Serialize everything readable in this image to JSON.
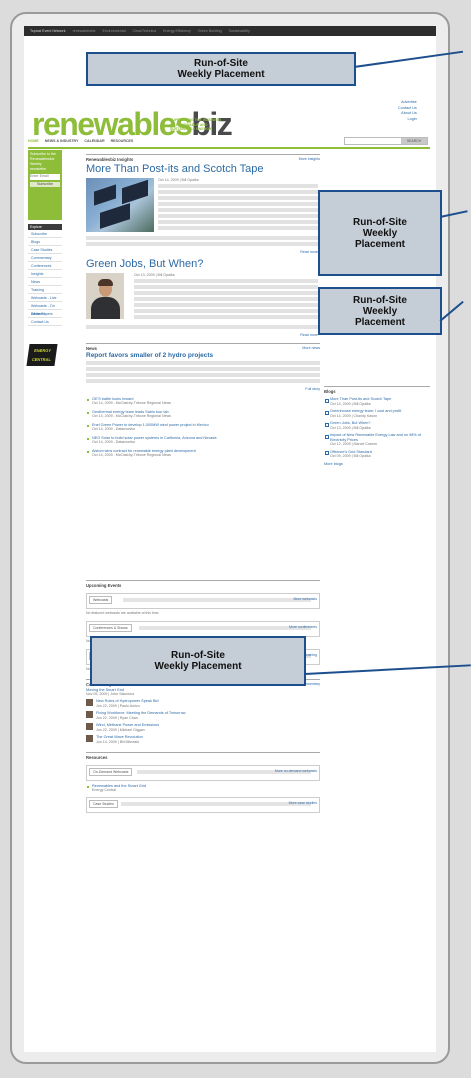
{
  "topbar": {
    "items": [
      "Topical Event Network",
      "renewablesbiz",
      "Environmental",
      "CleanTechnica",
      "Energy Efficiency",
      "Green Building",
      "Sustainability"
    ]
  },
  "placements": {
    "top": {
      "line1": "Run-of-Site",
      "line2": "Weekly Placement"
    },
    "right1": {
      "line1": "Run-of-Site",
      "line2": "Weekly",
      "line3": "Placement"
    },
    "right2": {
      "line1": "Run-of-Site",
      "line2": "Weekly",
      "line3": "Placement"
    },
    "middle": {
      "line1": "Run-of-Site",
      "line2": "Weekly Placement"
    }
  },
  "header": {
    "logo_a": "renewables",
    "logo_b": "biz",
    "tagline": [
      "SUPPORTING THE BUSINESS",
      "OF RENEWABLE AND",
      "SUSTAINABLE ENERGY"
    ],
    "links": [
      "Advertise",
      "Contact Us",
      "About Us",
      "Login"
    ],
    "search_button": "SEARCH"
  },
  "nav": [
    "HOME",
    "NEWS & INDUSTRY",
    "CALENDAR",
    "RESOURCES"
  ],
  "sidebar": {
    "newsletter_lines": [
      "Subscribe to the",
      "Renewablesbiz",
      "Weekly",
      "newsletter"
    ],
    "email_placeholder": "Enter Email",
    "subscribe_button": "Subscribe",
    "section_label": "Explore",
    "items": [
      "Subscribe",
      "Blogs",
      "Case Studies",
      "Commentary",
      "Conferences",
      "Insights",
      "News",
      "Training",
      "Webcasts - Live",
      "Webcasts - On Demand",
      "White Papers",
      "Contact Us"
    ],
    "logo_badge": "ENERGY CENTRAL"
  },
  "insights": {
    "heading": "Renewablesbiz Insights",
    "more": "More insights",
    "article1": {
      "title": "More Than Post-its and Scotch Tape",
      "date": "Oct 14, 2009 | Bill Opalka",
      "read_more": "Read more"
    },
    "article2": {
      "title": "Green Jobs, But When?",
      "date": "Oct 13, 2009 | Bill Opalka",
      "read_more": "Read more"
    }
  },
  "news": {
    "heading": "News",
    "more": "More news",
    "lead_title": "Report favors smaller of 2 hydro projects",
    "full_story": "Full story",
    "items": [
      {
        "title": "GE'S battle looks Inward",
        "src": "Oct 14, 2009 - McClatchy-Tribune Regional News"
      },
      {
        "title": "Geothermal energy team leads Sabin tour lab",
        "src": "Oct 14, 2009 - McClatchy-Tribune Regional News"
      },
      {
        "title": "Enel Green Power to develop 1,000MW wind power project in Mexico",
        "src": "Oct 14, 2009 - Datamonitor"
      },
      {
        "title": "NEO Solar to build solar power systems in California, Arizona and Nevada",
        "src": "Oct 14, 2009 - Datamonitor"
      },
      {
        "title": "Alstom wins contract for renewable energy plant development",
        "src": "Oct 14, 2009 - McClatchy-Tribune Regional News"
      }
    ]
  },
  "events": {
    "heading": "Upcoming Events",
    "boxes": [
      {
        "tab": "Webcasts",
        "more": "More webcasts",
        "note": "No featured webcasts are available at this time."
      },
      {
        "tab": "Conferences & Shows",
        "more": "More conferences",
        "note": "No featured conferences are available at this time."
      },
      {
        "tab": "Training",
        "more": "More training",
        "note": "No featured training is available at this time."
      }
    ]
  },
  "commentary": {
    "heading": "Commentary",
    "more": "More commentary",
    "lead": {
      "title": "Moving the Smart Grid",
      "date": "Nov 05, 2009 | John Sakowicz"
    },
    "items": [
      {
        "title": "New Roles of Hydropower Speak Bid",
        "date": "Jun 22, 2009 | Paolo Amico"
      },
      {
        "title": "Fixing Workforce: Meeting the Demands of Tomorrow",
        "date": "Jun 22, 2009 | Ryan Chan"
      },
      {
        "title": "Wind, Methane Power and Emissions",
        "date": "Jun 22, 2009 | Michael Giggan"
      },
      {
        "title": "The Great Wave Revolution",
        "date": "Jun 14, 2009 | Bill Milewski"
      }
    ]
  },
  "resources": {
    "heading": "Resources",
    "tab1": "On-Demand Webcasts",
    "more1": "More on-demand webcasts",
    "item": "Renewables and the Smart Grid",
    "item_src": "Energy Central",
    "tab2": "Case Studies",
    "more2": "More case studies"
  },
  "blogs": {
    "heading": "Blogs",
    "items": [
      {
        "title": "More Than Post-its and Scotch Tape",
        "date": "Oct 14, 2009 | Bill Opalka"
      },
      {
        "title": "Greenhouse energy team: I cost and profit",
        "date": "Oct 14, 2009 | Chandy Kason"
      },
      {
        "title": "Green Jobs, But When?",
        "date": "Oct 13, 2009 | Bill Opalka"
      },
      {
        "title": "Impact of New Renewable Energy Law and on 98% of Electricity Prices",
        "date": "Oct 12, 2009 | Marcel Cramer"
      },
      {
        "title": "Offshore's Grid Standard",
        "date": "Oct 09, 2009 | Bill Opalka"
      }
    ],
    "more": "More blogs"
  }
}
